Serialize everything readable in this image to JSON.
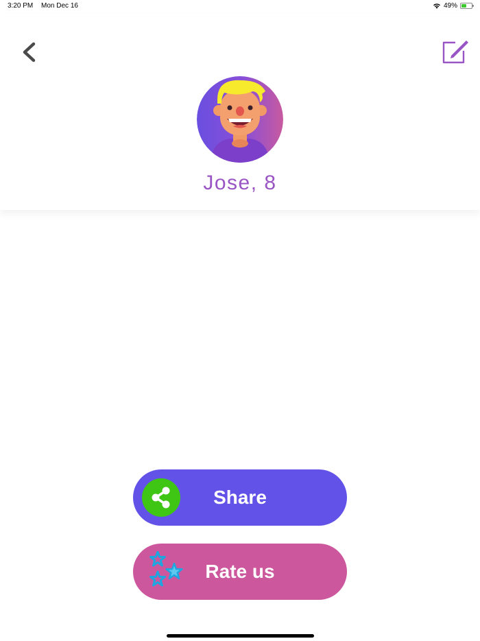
{
  "status_bar": {
    "time": "3:20 PM",
    "date": "Mon Dec 16",
    "battery_percent": "49%",
    "battery_level": 0.49
  },
  "header": {
    "profile_name": "Jose, 8"
  },
  "actions": {
    "share_label": "Share",
    "rate_label": "Rate us"
  },
  "colors": {
    "name_text": "#9a55c4",
    "edit_icon": "#9a55c4",
    "share_button": "#6252e8",
    "share_icon_bg": "#3fc614",
    "rate_button": "#cc579c",
    "stars": "#1da6e0"
  },
  "icons": {
    "back": "chevron-left-icon",
    "edit": "edit-icon",
    "share": "share-icon",
    "rate": "stars-icon",
    "wifi": "wifi-icon",
    "battery": "battery-icon"
  }
}
